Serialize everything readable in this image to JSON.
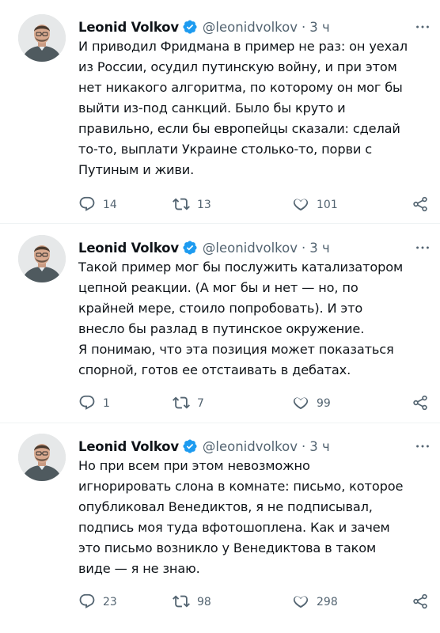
{
  "tweets": [
    {
      "author": {
        "name": "Leonid Volkov",
        "handle": "@leonidvolkov",
        "time": "3 ч"
      },
      "text": "И приводил Фридмана в пример не раз: он уехал\nиз России, осудил путинскую войну, и при этом\nнет никакого алгоритма, по которому он мог бы\nвыйти из-под санкций. Было бы круто и\nправильно, если бы европейцы сказали: сделай\nто-то, выплати Украине столько-то, порви с\nПутиным и живи.",
      "replies": "14",
      "retweets": "13",
      "likes": "101"
    },
    {
      "author": {
        "name": "Leonid Volkov",
        "handle": "@leonidvolkov",
        "time": "3 ч"
      },
      "text": "Такой пример мог бы послужить катализатором\nцепной реакции. (А мог бы и нет — но, по\nкрайней мере, стоило попробовать). И это\nвнесло бы разлад в путинское окружение.\nЯ понимаю, что эта позиция может показаться\nспорной, готов ее отстаивать в дебатах.",
      "replies": "1",
      "retweets": "7",
      "likes": "99"
    },
    {
      "author": {
        "name": "Leonid Volkov",
        "handle": "@leonidvolkov",
        "time": "3 ч"
      },
      "text": "Но при всем при этом невозможно\nигнорировать слона в комнате: письмо, которое\nопубликовал Венедиктов, я не подписывал,\nподпись моя туда вфотошоплена. Как и зачем\nэто письмо возникло у Венедиктова в таком\nвиде — я не знаю.",
      "replies": "23",
      "retweets": "98",
      "likes": "298"
    }
  ],
  "dot_separator": "·",
  "more_icon": "more-horizontal-icon",
  "colors": {
    "text": "#0f1419",
    "secondary": "#536471",
    "verified": "#1d9bf0",
    "divider": "#eff3f4"
  }
}
